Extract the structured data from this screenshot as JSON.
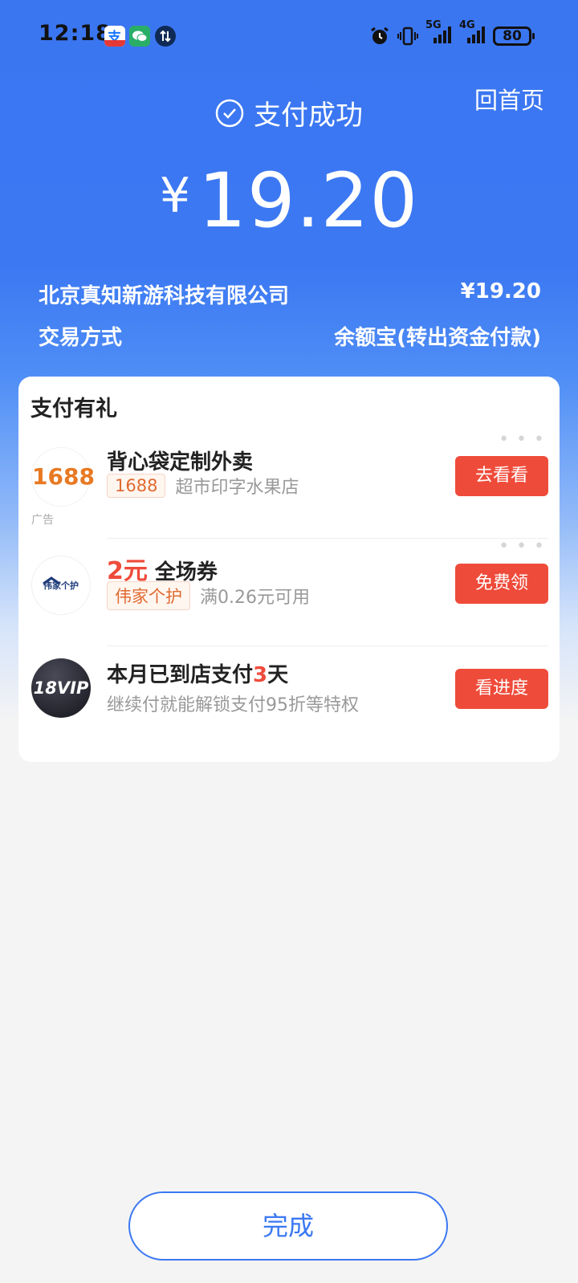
{
  "status_bar": {
    "time": "12:18",
    "signal_1": "5G",
    "signal_2": "4G",
    "battery": "80"
  },
  "header": {
    "home_label": "回首页",
    "status": "支付成功",
    "currency": "¥",
    "amount": "19.20"
  },
  "details": {
    "merchant": "北京真知新游科技有限公司",
    "merchant_amount": "¥19.20",
    "method_label": "交易方式",
    "method_value": "余额宝(转出资金付款)"
  },
  "gifts": {
    "title": "支付有礼",
    "items": [
      {
        "logo_text": "1688",
        "title": "背心袋定制外卖",
        "tag": "1688",
        "desc": "超市印字水果店",
        "ad_label": "广告",
        "button": "去看看"
      },
      {
        "logo_text": "伟家个护",
        "title_highlight": "2元",
        "title_rest": " 全场券",
        "tag": "伟家个护",
        "desc": "满0.26元可用",
        "button": "免费领"
      },
      {
        "logo_text": "18VIP",
        "title_pre": "本月已到店支付",
        "title_highlight": "3",
        "title_post": "天",
        "desc": "继续付就能解锁支付95折等特权",
        "button": "看进度"
      }
    ]
  },
  "footer": {
    "done_label": "完成"
  },
  "colors": {
    "primary_blue": "#3b78f2",
    "cta_red": "#ef4b3a",
    "tag_orange": "#e06a30"
  }
}
